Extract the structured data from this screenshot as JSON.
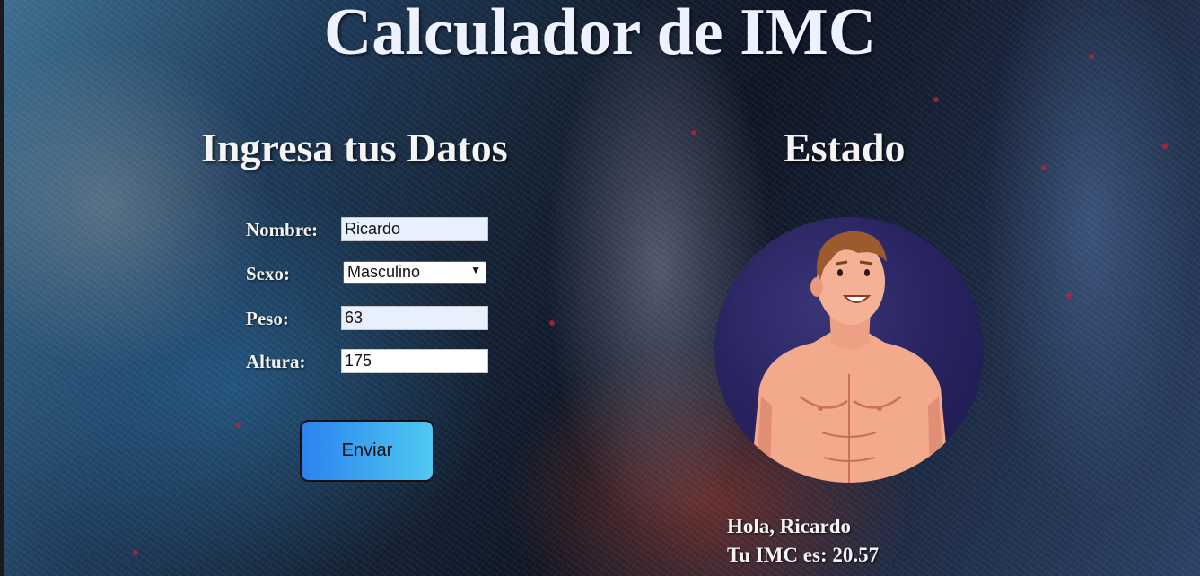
{
  "header": {
    "title": "Calculador de IMC"
  },
  "form": {
    "title": "Ingresa tus Datos",
    "name_label": "Nombre:",
    "name_value": "Ricardo",
    "sex_label": "Sexo:",
    "sex_value": "Masculino",
    "weight_label": "Peso:",
    "weight_value": "63",
    "height_label": "Altura:",
    "height_value": "175",
    "submit_label": "Enviar"
  },
  "status": {
    "title": "Estado",
    "greeting": "Hola, Ricardo",
    "imc_result": "Tu IMC es: 20.57"
  },
  "colors": {
    "button_gradient_start": "#2c82ee",
    "button_gradient_end": "#4fc9f1",
    "autofill_background": "#e8f0fe",
    "avatar_background": "#2a2562"
  }
}
